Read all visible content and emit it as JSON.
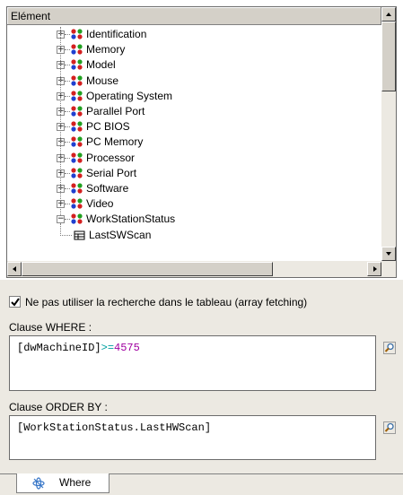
{
  "tree": {
    "column_header": "Elément",
    "items": [
      {
        "label": "Identification",
        "expander": "+",
        "icon": "table-group-icon"
      },
      {
        "label": "Memory",
        "expander": "+",
        "icon": "table-group-icon"
      },
      {
        "label": "Model",
        "expander": "+",
        "icon": "table-group-icon"
      },
      {
        "label": "Mouse",
        "expander": "+",
        "icon": "table-group-icon"
      },
      {
        "label": "Operating System",
        "expander": "+",
        "icon": "table-group-icon"
      },
      {
        "label": "Parallel Port",
        "expander": "+",
        "icon": "table-group-icon"
      },
      {
        "label": "PC BIOS",
        "expander": "+",
        "icon": "table-group-icon"
      },
      {
        "label": "PC Memory",
        "expander": "+",
        "icon": "table-group-icon"
      },
      {
        "label": "Processor",
        "expander": "+",
        "icon": "table-group-icon"
      },
      {
        "label": "Serial Port",
        "expander": "+",
        "icon": "table-group-icon"
      },
      {
        "label": "Software",
        "expander": "+",
        "icon": "table-group-icon"
      },
      {
        "label": "Video",
        "expander": "+",
        "icon": "table-group-icon"
      },
      {
        "label": "WorkStationStatus",
        "expander": "−",
        "icon": "table-group-icon"
      },
      {
        "label": "LastSWScan",
        "expander": "",
        "icon": "field-icon"
      }
    ]
  },
  "options": {
    "array_fetching_label": "Ne pas utiliser la recherche dans le tableau (array fetching)",
    "array_fetching_checked": true
  },
  "where": {
    "label": "Clause WHERE :",
    "field": "[dwMachineID]",
    "operator": ">=",
    "value": "4575"
  },
  "order_by": {
    "label": "Clause ORDER BY :",
    "value": "[WorkStationStatus.LastHWScan]"
  },
  "tabs": [
    {
      "label": "Where",
      "icon": "where-icon"
    }
  ],
  "colors": {
    "operator": "#00a0a0",
    "number": "#a000a0",
    "panel": "#ece9e2"
  }
}
